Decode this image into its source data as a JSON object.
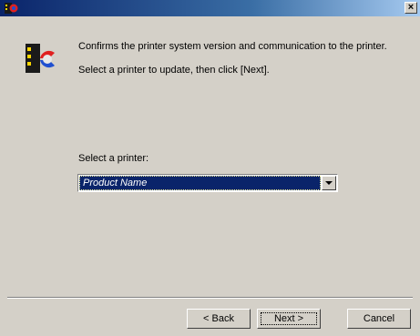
{
  "window": {
    "close_glyph": "×"
  },
  "content": {
    "description_line1": "Confirms the printer system version and communication to the printer.",
    "description_line2": "Select a printer to update, then click [Next].",
    "select_label": "Select a printer:",
    "printer_select": {
      "selected_value": "Product Name"
    }
  },
  "buttons": {
    "back": "< Back",
    "next": "Next >",
    "cancel": "Cancel"
  },
  "colors": {
    "titlebar": "#0a246a",
    "dialog_bg": "#d4d0c8",
    "selection_bg": "#0a246a"
  },
  "icons": {
    "app": "wizard-app-icon",
    "wizard": "printer-update-icon",
    "dropdown": "chevron-down-icon",
    "close": "close-icon"
  }
}
